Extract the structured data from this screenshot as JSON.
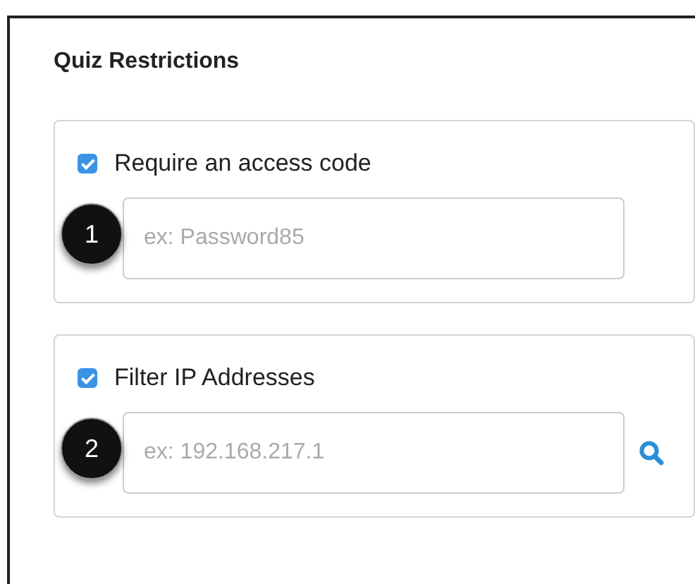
{
  "title": "Quiz Restrictions",
  "sections": [
    {
      "kind": "plain",
      "label": "Require an access code",
      "checked": true,
      "badge": "1",
      "placeholder": "ex: Password85"
    },
    {
      "kind": "search",
      "label": "Filter IP Addresses",
      "checked": true,
      "badge": "2",
      "placeholder": "ex: 192.168.217.1"
    }
  ]
}
